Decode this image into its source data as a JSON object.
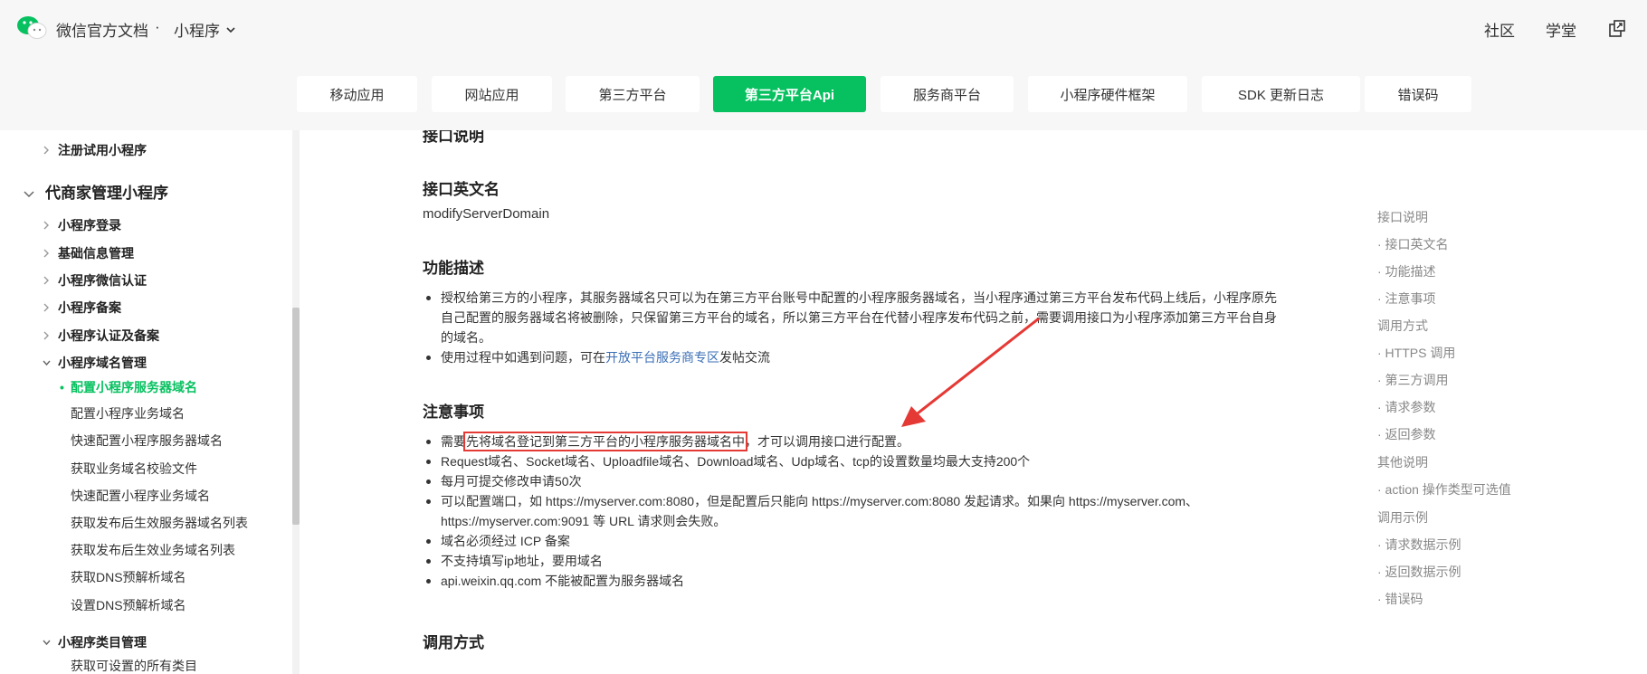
{
  "header": {
    "brand": "微信官方文档",
    "separator": "·",
    "product": "小程序",
    "links": [
      "社区",
      "学堂"
    ]
  },
  "tabs": [
    {
      "label": "移动应用",
      "active": false
    },
    {
      "label": "网站应用",
      "active": false
    },
    {
      "label": "第三方平台",
      "active": false
    },
    {
      "label": "第三方平台Api",
      "active": true
    },
    {
      "label": "服务商平台",
      "active": false
    },
    {
      "label": "小程序硬件框架",
      "active": false
    },
    {
      "label": "SDK 更新日志",
      "active": false
    },
    {
      "label": "错误码",
      "active": false
    }
  ],
  "sidebar": {
    "top_item": "注册试用小程序",
    "group": "代商家管理小程序",
    "items": [
      "小程序登录",
      "基础信息管理",
      "小程序微信认证",
      "小程序备案",
      "小程序认证及备案",
      "小程序域名管理"
    ],
    "sub_items": [
      "配置小程序服务器域名",
      "配置小程序业务域名",
      "快速配置小程序服务器域名",
      "获取业务域名校验文件",
      "快速配置小程序业务域名",
      "获取发布后生效服务器域名列表",
      "获取发布后生效业务域名列表",
      "获取DNS预解析域名",
      "设置DNS预解析域名"
    ],
    "bottom_item": "小程序类目管理",
    "bottom_sub": "获取可设置的所有类目"
  },
  "content": {
    "cut_heading": "接口说明",
    "api_name_heading": "接口英文名",
    "api_name": "modifyServerDomain",
    "desc_heading": "功能描述",
    "desc_1_line1": "授权给第三方的小程序，其服务器域名只可以为在第三方平台账号中配置的小程序服务器域名，当小程序通过第三方平台发布代码上线后，小程序原先",
    "desc_1_line2": "自己配置的服务器域名将被删除，只保留第三方平台的域名，所以第三方平台在代替小程序发布代码之前，需要调用接口为小程序添加第三方平台自身",
    "desc_1_line3": "的域名。",
    "desc_2_prefix": "使用过程中如遇到问题，可在",
    "desc_2_link": "开放平台服务商专区",
    "desc_2_suffix": "发帖交流",
    "notes_heading": "注意事项",
    "note_1_prefix": "需要",
    "note_1_highlight": "先将域名登记到第三方平台的小程序服务器域名中",
    "note_1_suffix": "，才可以调用接口进行配置。",
    "note_2": "Request域名、Socket域名、Uploadfile域名、Download域名、Udp域名、tcp的设置数量均最大支持200个",
    "note_3": "每月可提交修改申请50次",
    "note_4_line1": "可以配置端口，如 https://myserver.com:8080，但是配置后只能向 https://myserver.com:8080 发起请求。如果向 https://myserver.com、",
    "note_4_line2": "https://myserver.com:9091 等 URL 请求则会失败。",
    "note_5": "域名必须经过 ICP 备案",
    "note_6": "不支持填写ip地址，要用域名",
    "note_7": "api.weixin.qq.com 不能被配置为服务器域名",
    "call_heading": "调用方式"
  },
  "toc": [
    {
      "label": "接口说明",
      "level": 1
    },
    {
      "label": "· 接口英文名",
      "level": 2
    },
    {
      "label": "· 功能描述",
      "level": 2
    },
    {
      "label": "· 注意事项",
      "level": 2
    },
    {
      "label": "调用方式",
      "level": 1
    },
    {
      "label": "· HTTPS 调用",
      "level": 2
    },
    {
      "label": "· 第三方调用",
      "level": 2
    },
    {
      "label": "· 请求参数",
      "level": 2
    },
    {
      "label": "· 返回参数",
      "level": 2
    },
    {
      "label": "其他说明",
      "level": 1
    },
    {
      "label": "· action 操作类型可选值",
      "level": 2
    },
    {
      "label": "调用示例",
      "level": 1
    },
    {
      "label": "· 请求数据示例",
      "level": 2
    },
    {
      "label": "· 返回数据示例",
      "level": 2
    },
    {
      "label": "· 错误码",
      "level": 2
    }
  ],
  "colors": {
    "accent": "#07c160",
    "link": "#3b6fb6",
    "annotation": "#e53935"
  }
}
